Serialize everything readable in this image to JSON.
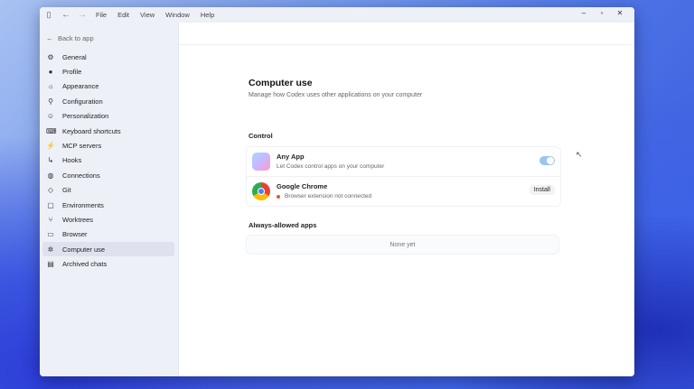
{
  "titlebar": {
    "menu": [
      "File",
      "Edit",
      "View",
      "Window",
      "Help"
    ],
    "controls": {
      "minimize": "‒",
      "maximize": "▫",
      "close": "✕"
    }
  },
  "sidebar": {
    "back_label": "Back to app",
    "items": [
      {
        "label": "General",
        "icon": "gear-icon"
      },
      {
        "label": "Profile",
        "icon": "user-icon"
      },
      {
        "label": "Appearance",
        "icon": "sun-icon"
      },
      {
        "label": "Configuration",
        "icon": "sliders-icon"
      },
      {
        "label": "Personalization",
        "icon": "smile-icon"
      },
      {
        "label": "Keyboard shortcuts",
        "icon": "keyboard-icon"
      },
      {
        "label": "MCP servers",
        "icon": "plug-icon"
      },
      {
        "label": "Hooks",
        "icon": "hook-icon"
      },
      {
        "label": "Connections",
        "icon": "globe-icon"
      },
      {
        "label": "Git",
        "icon": "git-icon"
      },
      {
        "label": "Environments",
        "icon": "box-icon"
      },
      {
        "label": "Worktrees",
        "icon": "branch-icon"
      },
      {
        "label": "Browser",
        "icon": "browser-icon"
      },
      {
        "label": "Computer use",
        "icon": "cursor-sparkle-icon",
        "active": true
      },
      {
        "label": "Archived chats",
        "icon": "archive-icon"
      }
    ]
  },
  "main": {
    "title": "Computer use",
    "subtitle": "Manage how Codex uses other applications on your computer",
    "control_heading": "Control",
    "control_rows": [
      {
        "name": "Any App",
        "desc": "Let Codex control apps on your computer",
        "toggle_on": true
      },
      {
        "name": "Google Chrome",
        "desc": "Browser extension not connected",
        "status_color": "#e05a2a",
        "action": "Install"
      }
    ],
    "allowed_heading": "Always-allowed apps",
    "allowed_empty": "None yet"
  },
  "colors": {
    "accent": "#9ec3f0",
    "sidebar_bg": "#eef0f8"
  }
}
